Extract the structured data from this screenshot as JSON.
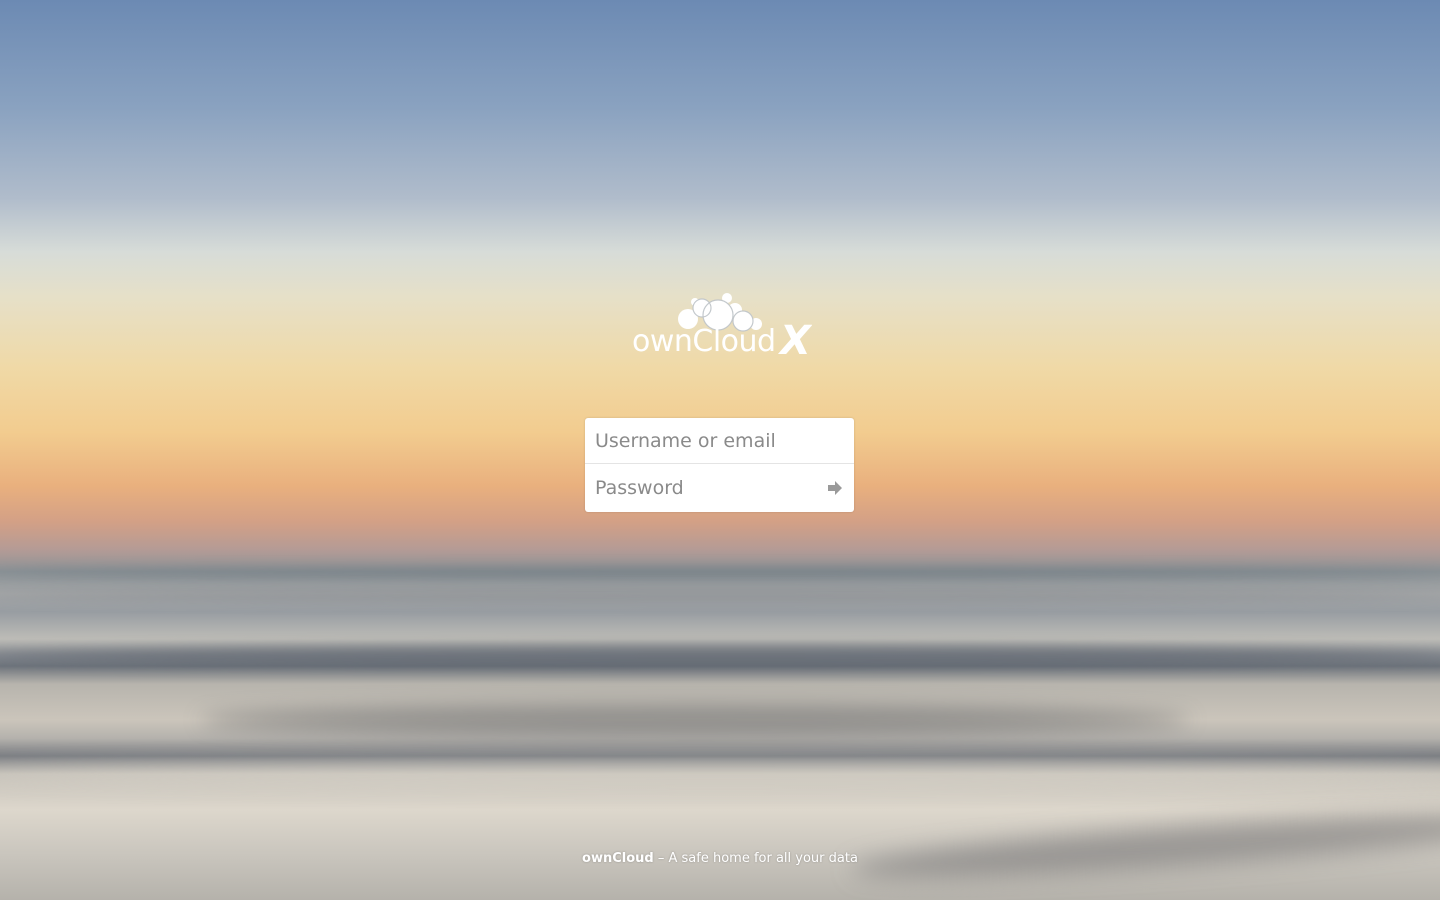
{
  "logo": {
    "wordmark": "ownCloud",
    "edition": "X",
    "icon": "cloud-icon",
    "color": "#ffffff"
  },
  "login": {
    "username_placeholder": "Username or email",
    "username_value": "",
    "password_placeholder": "Password",
    "password_value": "",
    "submit_icon": "arrow-right-icon"
  },
  "footer": {
    "brand": "ownCloud",
    "separator": " – ",
    "tagline": "A safe home for all your data"
  }
}
